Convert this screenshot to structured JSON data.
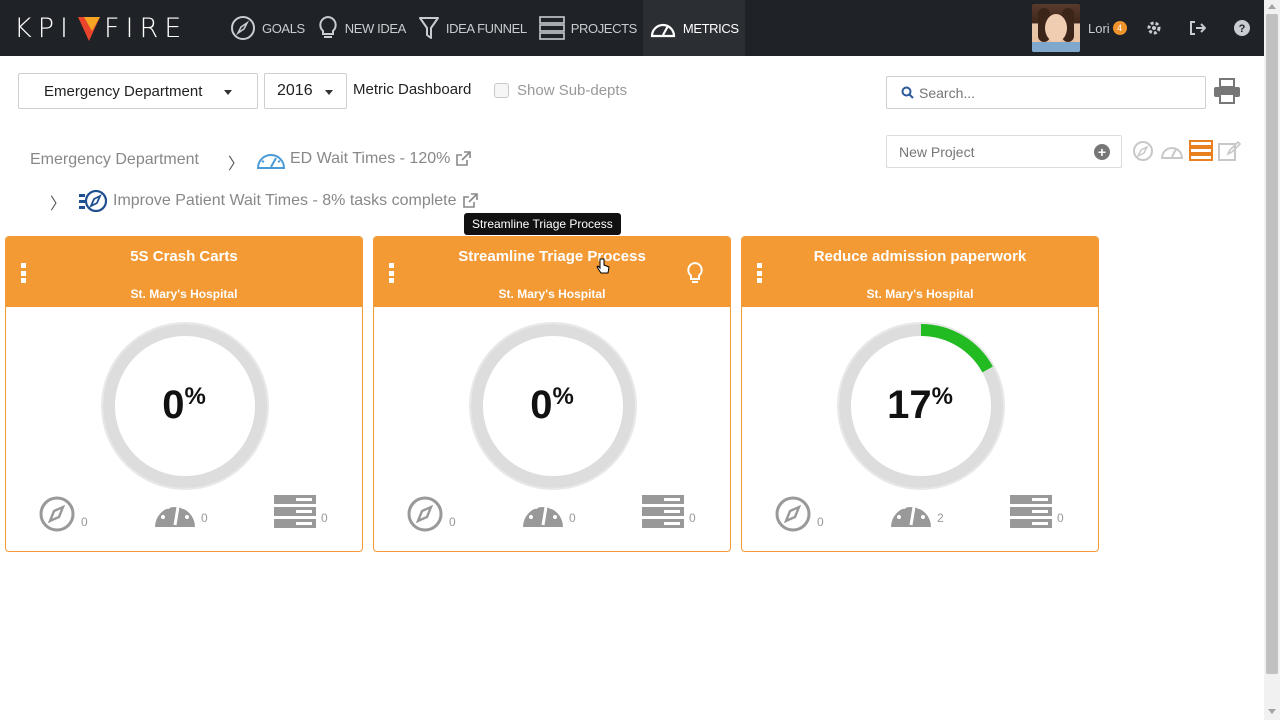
{
  "nav": {
    "logo": "KPI FIRE",
    "items": [
      {
        "label": "GOALS",
        "icon": "compass-icon"
      },
      {
        "label": "NEW IDEA",
        "icon": "lightbulb-icon"
      },
      {
        "label": "IDEA FUNNEL",
        "icon": "funnel-icon"
      },
      {
        "label": "PROJECTS",
        "icon": "projects-icon"
      },
      {
        "label": "METRICS",
        "icon": "speedometer-icon"
      }
    ],
    "active": "METRICS",
    "user": {
      "name": "Lori",
      "badge": "4"
    }
  },
  "filters": {
    "department": "Emergency Department",
    "year": "2016",
    "dashboard_title": "Metric Dashboard",
    "show_subdepts_label": "Show Sub-depts",
    "search_placeholder": "Search...",
    "new_project_placeholder": "New Project"
  },
  "breadcrumbs": {
    "department": "Emergency Department",
    "metric": "ED Wait Times - 120%",
    "goal": "Improve Patient Wait Times - 8% tasks complete"
  },
  "tooltip": "Streamline Triage Process",
  "cards": [
    {
      "title": "5S Crash Carts",
      "subtitle": "St. Mary's Hospital",
      "percent": "0",
      "percent_value": 0,
      "goals": "0",
      "metrics": "0",
      "projects": "0",
      "has_bulb": false
    },
    {
      "title": "Streamline Triage Process",
      "subtitle": "St. Mary's Hospital",
      "percent": "0",
      "percent_value": 0,
      "goals": "0",
      "metrics": "0",
      "projects": "0",
      "has_bulb": true
    },
    {
      "title": "Reduce admission paperwork",
      "subtitle": "St. Mary's Hospital",
      "percent": "17",
      "percent_value": 17,
      "goals": "0",
      "metrics": "2",
      "projects": "0",
      "has_bulb": false
    }
  ],
  "colors": {
    "nav_bg": "#1f2226",
    "accent": "#f39a35",
    "progress": "#22bb22",
    "ring": "#dddddd"
  }
}
